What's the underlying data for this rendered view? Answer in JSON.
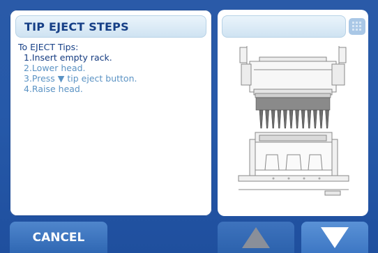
{
  "instructions": {
    "title": "TIP EJECT STEPS",
    "intro": "To EJECT Tips:",
    "steps": [
      "1.Insert empty rack.",
      "2.Lower head.",
      "3.Press ▼ tip eject button.",
      "4.Raise head."
    ],
    "active_step": 1
  },
  "illustration": {
    "grid_icon": "grid-icon",
    "image_icon": "pipette-head-tip-rack-icon"
  },
  "buttons": {
    "cancel_label": "CANCEL",
    "up_icon": "triangle-up-icon",
    "down_icon": "triangle-down-icon"
  },
  "colors": {
    "background": "#2659a9",
    "title_text": "#163f86",
    "active_step": "#143b80",
    "inactive_step": "#5b93c4",
    "up_arrow_disabled": "#8a8f99",
    "down_arrow": "#ffffff"
  }
}
